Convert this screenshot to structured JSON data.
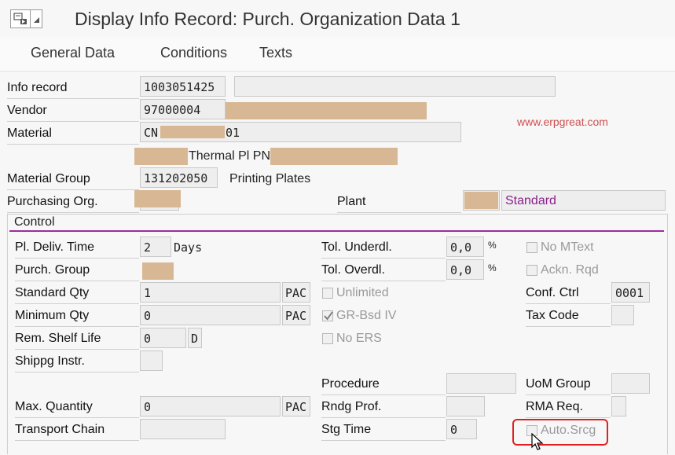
{
  "title": "Display Info Record: Purch. Organization Data 1",
  "tabs": [
    "General Data",
    "Conditions",
    "Texts"
  ],
  "header": {
    "info_record_label": "Info record",
    "info_record_value": "1003051425",
    "vendor_label": "Vendor",
    "vendor_value": "97000004",
    "material_label": "Material",
    "material_value_prefix": "CN",
    "material_value_suffix": "01",
    "material_desc": "Thermal Pl PN",
    "material_group_label": "Material Group",
    "material_group_value": "131202050",
    "material_group_desc": "Printing Plates",
    "purch_org_label": "Purchasing Org.",
    "plant_label": "Plant",
    "plant_desc": "Standard"
  },
  "watermark": "www.erpgreat.com",
  "control": {
    "section_title": "Control",
    "pl_deliv_time_label": "Pl. Deliv. Time",
    "pl_deliv_time_value": "2",
    "pl_deliv_time_unit": "Days",
    "purch_group_label": "Purch. Group",
    "standard_qty_label": "Standard Qty",
    "standard_qty_value": "1",
    "standard_qty_unit": "PAC",
    "minimum_qty_label": "Minimum Qty",
    "minimum_qty_value": "0",
    "minimum_qty_unit": "PAC",
    "rem_shelf_life_label": "Rem. Shelf Life",
    "rem_shelf_life_value": "0",
    "rem_shelf_life_unit": "D",
    "shippg_instr_label": "Shippg Instr.",
    "max_quantity_label": "Max. Quantity",
    "max_quantity_value": "0",
    "max_quantity_unit": "PAC",
    "transport_chain_label": "Transport Chain",
    "tol_underdl_label": "Tol. Underdl.",
    "tol_underdl_value": "0,0",
    "tol_overdl_label": "Tol. Overdl.",
    "tol_overdl_value": "0,0",
    "percent": "%",
    "unlimited_label": "Unlimited",
    "gr_bsd_iv_label": "GR-Bsd IV",
    "no_ers_label": "No ERS",
    "procedure_label": "Procedure",
    "rndg_prof_label": "Rndg Prof.",
    "stg_time_label": "Stg Time",
    "stg_time_value": "0",
    "no_mtext_label": "No MText",
    "ackn_rqd_label": "Ackn. Rqd",
    "conf_ctrl_label": "Conf. Ctrl",
    "conf_ctrl_value": "0001",
    "tax_code_label": "Tax Code",
    "uom_group_label": "UoM Group",
    "rma_req_label": "RMA Req.",
    "auto_srcg_label": "Auto.Srcg"
  },
  "colors": {
    "accent_purple": "#9b2d9b",
    "highlight_red": "#e02020",
    "redacted": "#d8b894"
  }
}
